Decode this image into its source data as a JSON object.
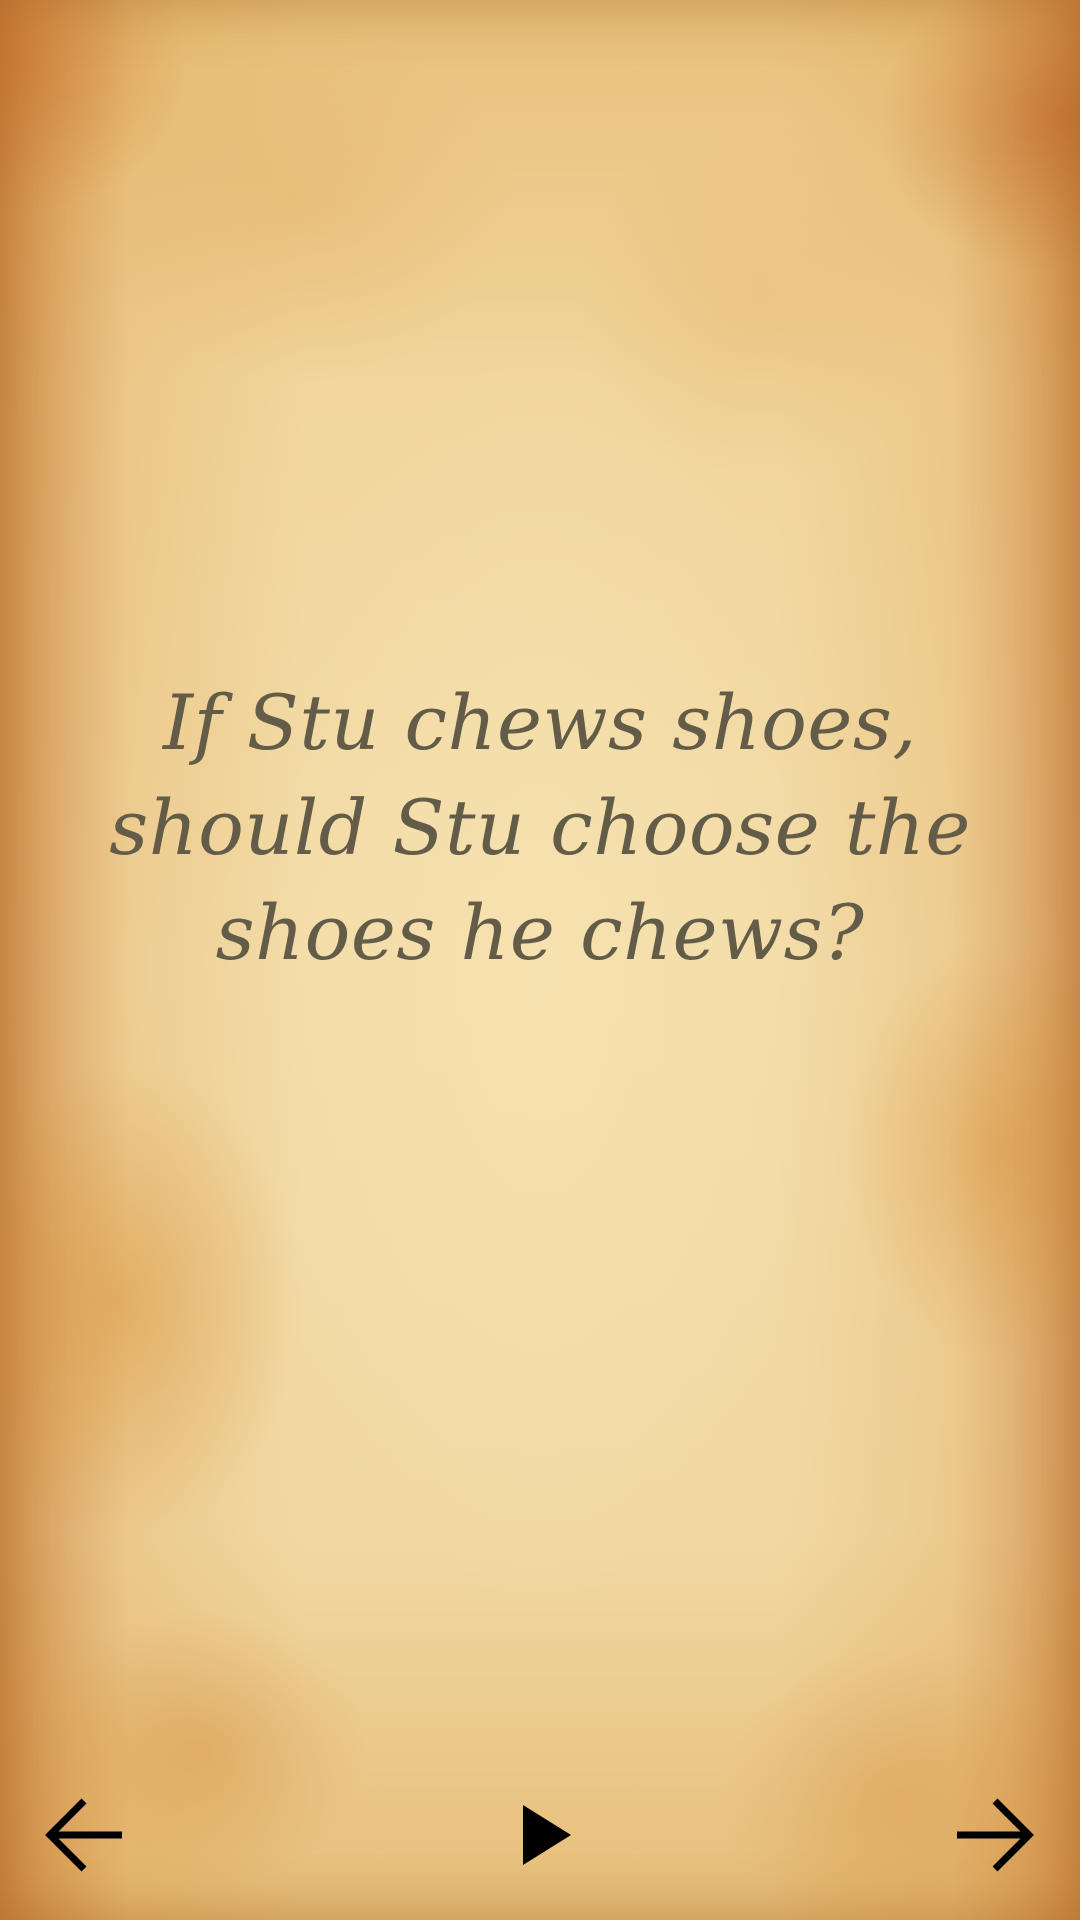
{
  "riddle": {
    "text": "If Stu chews shoes, should Stu choose the shoes he chews?"
  },
  "controls": {
    "previous_icon": "arrow-left-icon",
    "play_icon": "play-icon",
    "next_icon": "arrow-right-icon"
  },
  "colors": {
    "text": "#625c48",
    "icon": "#000000",
    "parchment": "#f3dca8"
  }
}
